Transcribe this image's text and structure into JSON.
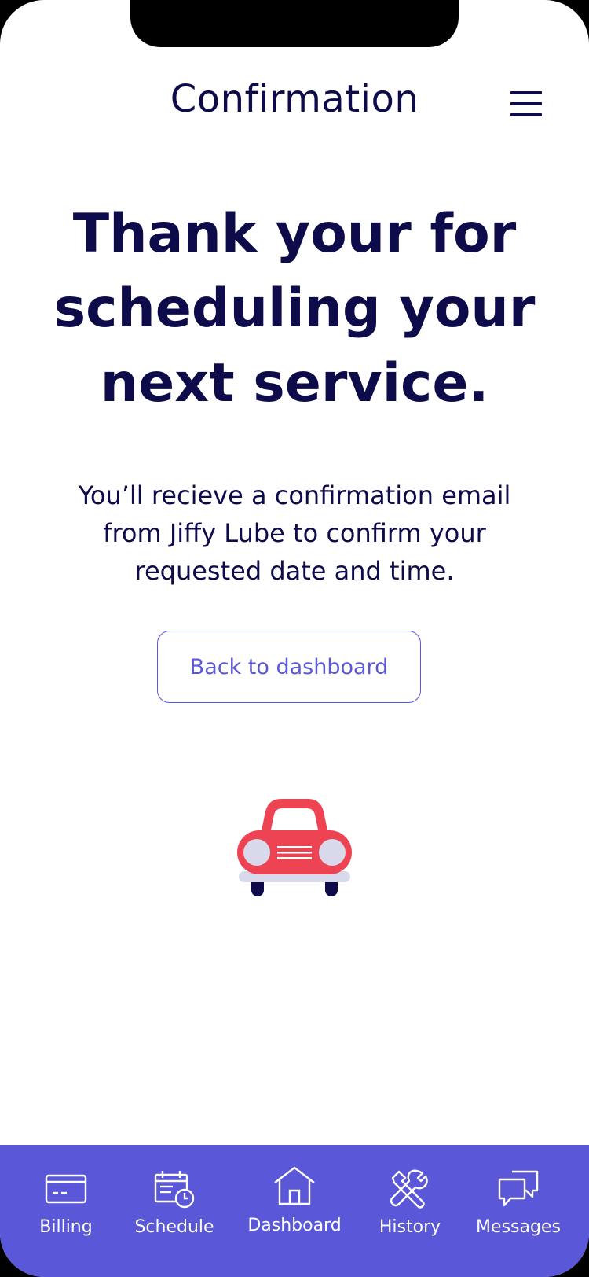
{
  "header": {
    "title": "Confirmation",
    "menu_icon": "hamburger-menu-icon"
  },
  "main": {
    "headline": "Thank your for scheduling your next service.",
    "message": "You’ll recieve a confirmation email from Jiffy Lube to confirm your requested date and time.",
    "dashboard_button_label": "Back to dashboard",
    "illustration_icon": "car-icon"
  },
  "tab_bar": {
    "items": [
      {
        "label": "Billing",
        "icon": "credit-card-icon"
      },
      {
        "label": "Schedule",
        "icon": "calendar-clock-icon"
      },
      {
        "label": "Dashboard",
        "icon": "home-icon"
      },
      {
        "label": "History",
        "icon": "tools-icon"
      },
      {
        "label": "Messages",
        "icon": "chat-bubbles-icon"
      }
    ]
  },
  "colors": {
    "primary_text": "#0d0b4a",
    "accent": "#5a57d8",
    "car_body": "#ee4352",
    "car_lights": "#d8daec",
    "background": "#ffffff"
  }
}
